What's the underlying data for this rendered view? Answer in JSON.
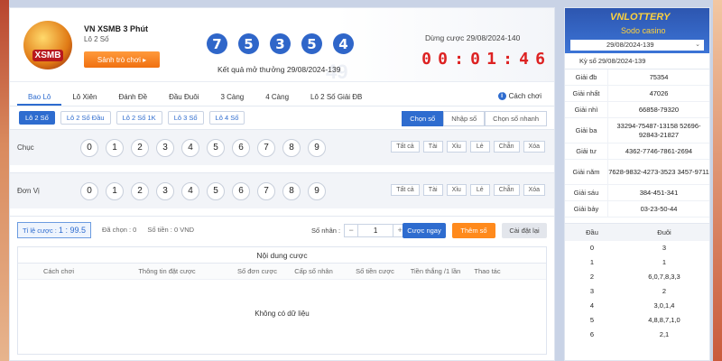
{
  "game": {
    "title": "VN XSMB 3 Phút",
    "subtitle": "Lô 2 Số",
    "hall_button": "Sảnh trò chơi ▸",
    "logo_text": "XSMB",
    "result_numbers": [
      "7",
      "5",
      "3",
      "5",
      "4"
    ],
    "result_label": "Kết quả mở thưởng 29/08/2024-139",
    "stop_label": "Dừng cược 29/08/2024-140",
    "countdown": [
      "0",
      "0",
      ":",
      "0",
      "1",
      ":",
      "4",
      "6"
    ],
    "watermark": "49"
  },
  "tabs": [
    {
      "label": "Bao Lô",
      "active": true
    },
    {
      "label": "Lô Xiên"
    },
    {
      "label": "Đánh Đề"
    },
    {
      "label": "Đầu Đuôi"
    },
    {
      "label": "3 Càng"
    },
    {
      "label": "4 Càng"
    },
    {
      "label": "Lô 2 Số Giải ĐB"
    }
  ],
  "howto": "Cách chơi",
  "subtabs": [
    {
      "label": "Lô 2 Số",
      "active": true
    },
    {
      "label": "Lô 2 Số Đầu"
    },
    {
      "label": "Lô 2 Số 1K"
    },
    {
      "label": "Lô 3 Số"
    },
    {
      "label": "Lô 4 Số"
    }
  ],
  "modes": [
    {
      "label": "Chọn số",
      "active": true
    },
    {
      "label": "Nhập số"
    },
    {
      "label": "Chọn số nhanh"
    }
  ],
  "rows": [
    {
      "label": "Chục",
      "numbers": [
        "0",
        "1",
        "2",
        "3",
        "4",
        "5",
        "6",
        "7",
        "8",
        "9"
      ]
    },
    {
      "label": "Đơn Vị",
      "numbers": [
        "0",
        "1",
        "2",
        "3",
        "4",
        "5",
        "6",
        "7",
        "8",
        "9"
      ]
    }
  ],
  "quick": [
    "Tất cả",
    "Tài",
    "Xỉu",
    "Lẻ",
    "Chẵn",
    "Xóa"
  ],
  "betbar": {
    "rate_label": "Tỉ lệ cược :",
    "rate_value": "1 : 99.5",
    "selected": "Đã chọn : 0",
    "amount": "Số tiền : 0 VND",
    "multiplier_label": "Số nhân :",
    "minus": "−",
    "multiplier_value": "1",
    "plus": "+",
    "bet_button": "Cược ngay",
    "add_button": "Thêm số",
    "reset_button": "Cài đặt lại"
  },
  "content": {
    "title": "Nội dung cược",
    "columns": [
      "Cách chơi",
      "Thông tin đặt cược",
      "Số đơn cược",
      "Cấp số nhân",
      "Số tiền cược",
      "Tiền thắng /1 lần",
      "Thao tác"
    ],
    "empty": "Không có dữ liệu"
  },
  "sidebar": {
    "brand": "VNLOTTERY",
    "brand2": "Sodo casino",
    "selected_period": "29/08/2024-139",
    "period_label": "Kỳ số 29/08/2024-139",
    "prizes": [
      {
        "name": "Giải đb",
        "value": "75354",
        "tall": false
      },
      {
        "name": "Giải nhất",
        "value": "47026",
        "tall": false
      },
      {
        "name": "Giải nhì",
        "value": "66858-79320",
        "tall": false
      },
      {
        "name": "Giải ba",
        "value": "33294-75487-13158 52696-92843-21827",
        "tall": true
      },
      {
        "name": "Giải tư",
        "value": "4362-7746-7861-2694",
        "tall": false
      },
      {
        "name": "Giải năm",
        "value": "7628-9832-4273-3523 3457-9711",
        "tall": true
      },
      {
        "name": "Giải sáu",
        "value": "384-451-341",
        "tall": false
      },
      {
        "name": "Giải bảy",
        "value": "03-23-50-44",
        "tall": false
      }
    ],
    "head_col": "Đầu",
    "tail_col": "Đuôi",
    "head_tail": [
      {
        "head": "0",
        "tail": "3"
      },
      {
        "head": "1",
        "tail": "1"
      },
      {
        "head": "2",
        "tail": "6,0,7,8,3,3"
      },
      {
        "head": "3",
        "tail": "2"
      },
      {
        "head": "4",
        "tail": "3,0,1,4"
      },
      {
        "head": "5",
        "tail": "4,8,8,7,1,0"
      },
      {
        "head": "6",
        "tail": "2,1"
      }
    ]
  }
}
